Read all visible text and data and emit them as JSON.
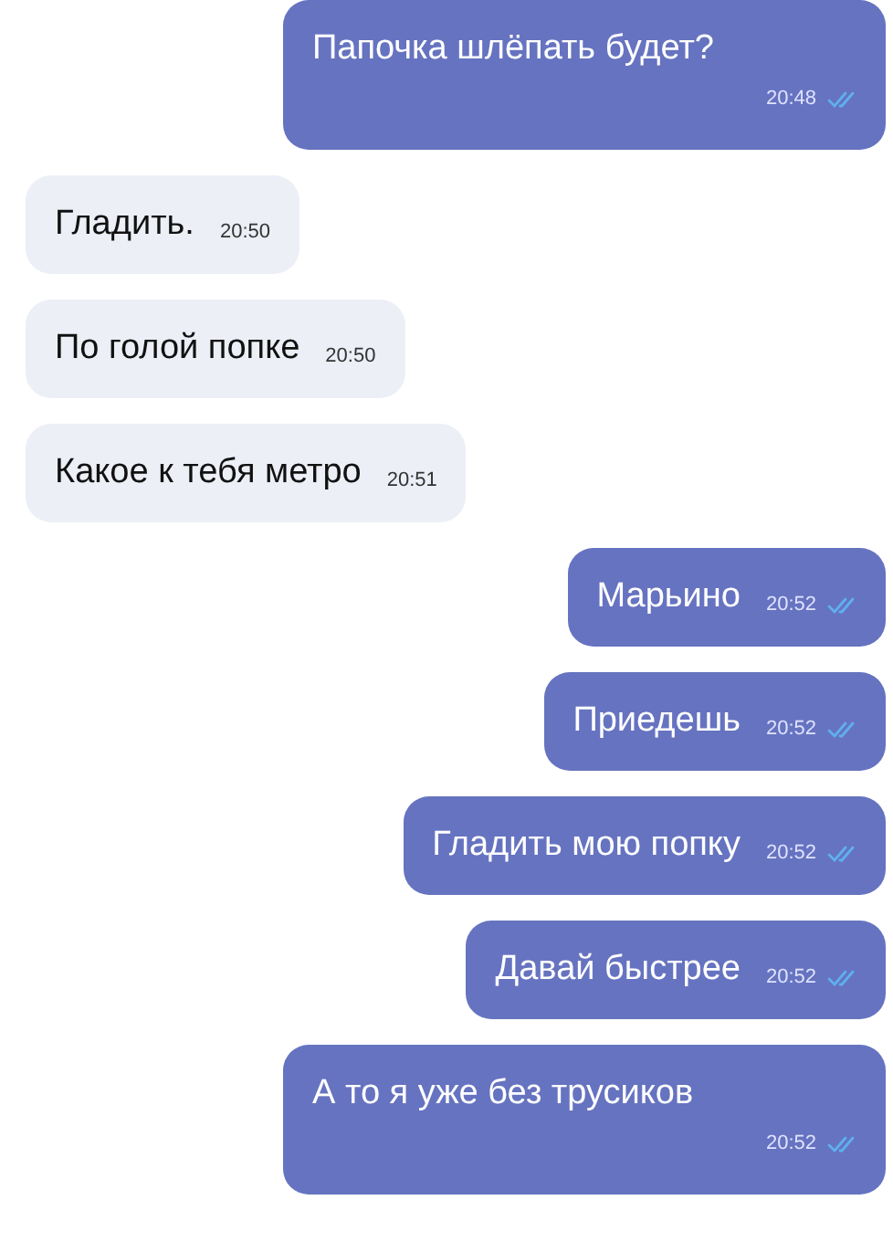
{
  "messages": [
    {
      "outgoing": true,
      "kind": "stacked",
      "text": "Папочка шлёпать будет?",
      "time": "20:48",
      "read": true
    },
    {
      "outgoing": false,
      "kind": "inline",
      "text": "Гладить.",
      "time": "20:50"
    },
    {
      "outgoing": false,
      "kind": "inline",
      "text": "По голой попке",
      "time": "20:50"
    },
    {
      "outgoing": false,
      "kind": "inline",
      "text": "Какое к тебя метро",
      "time": "20:51"
    },
    {
      "outgoing": true,
      "kind": "inline",
      "text": "Марьино",
      "time": "20:52",
      "read": true
    },
    {
      "outgoing": true,
      "kind": "inline",
      "text": "Приедешь",
      "time": "20:52",
      "read": true
    },
    {
      "outgoing": true,
      "kind": "inline",
      "text": "Гладить мою попку",
      "time": "20:52",
      "read": true
    },
    {
      "outgoing": true,
      "kind": "inline",
      "text": "Давай быстрее",
      "time": "20:52",
      "read": true
    },
    {
      "outgoing": true,
      "kind": "stacked",
      "text": "А то я уже без трусиков",
      "time": "20:52",
      "read": true
    }
  ]
}
